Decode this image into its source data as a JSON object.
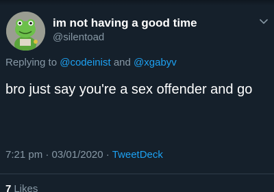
{
  "author": {
    "display_name": "im not having a good time",
    "handle": "@silentoad",
    "avatar_icon": "frog-avatar"
  },
  "reply": {
    "prefix": "Replying to",
    "mention_1": "@codeinist",
    "joiner": "and",
    "mention_2": "@xgabyv"
  },
  "tweet": {
    "text": "bro just say you're a sex offender and go"
  },
  "meta": {
    "time": "7:21 pm",
    "separator": "·",
    "date": "03/01/2020",
    "source": "TweetDeck"
  },
  "stats": {
    "likes_count": "7",
    "likes_label": "Likes"
  },
  "colors": {
    "background": "#15202b",
    "secondary_text": "#8899a6",
    "link": "#1da1f2"
  }
}
